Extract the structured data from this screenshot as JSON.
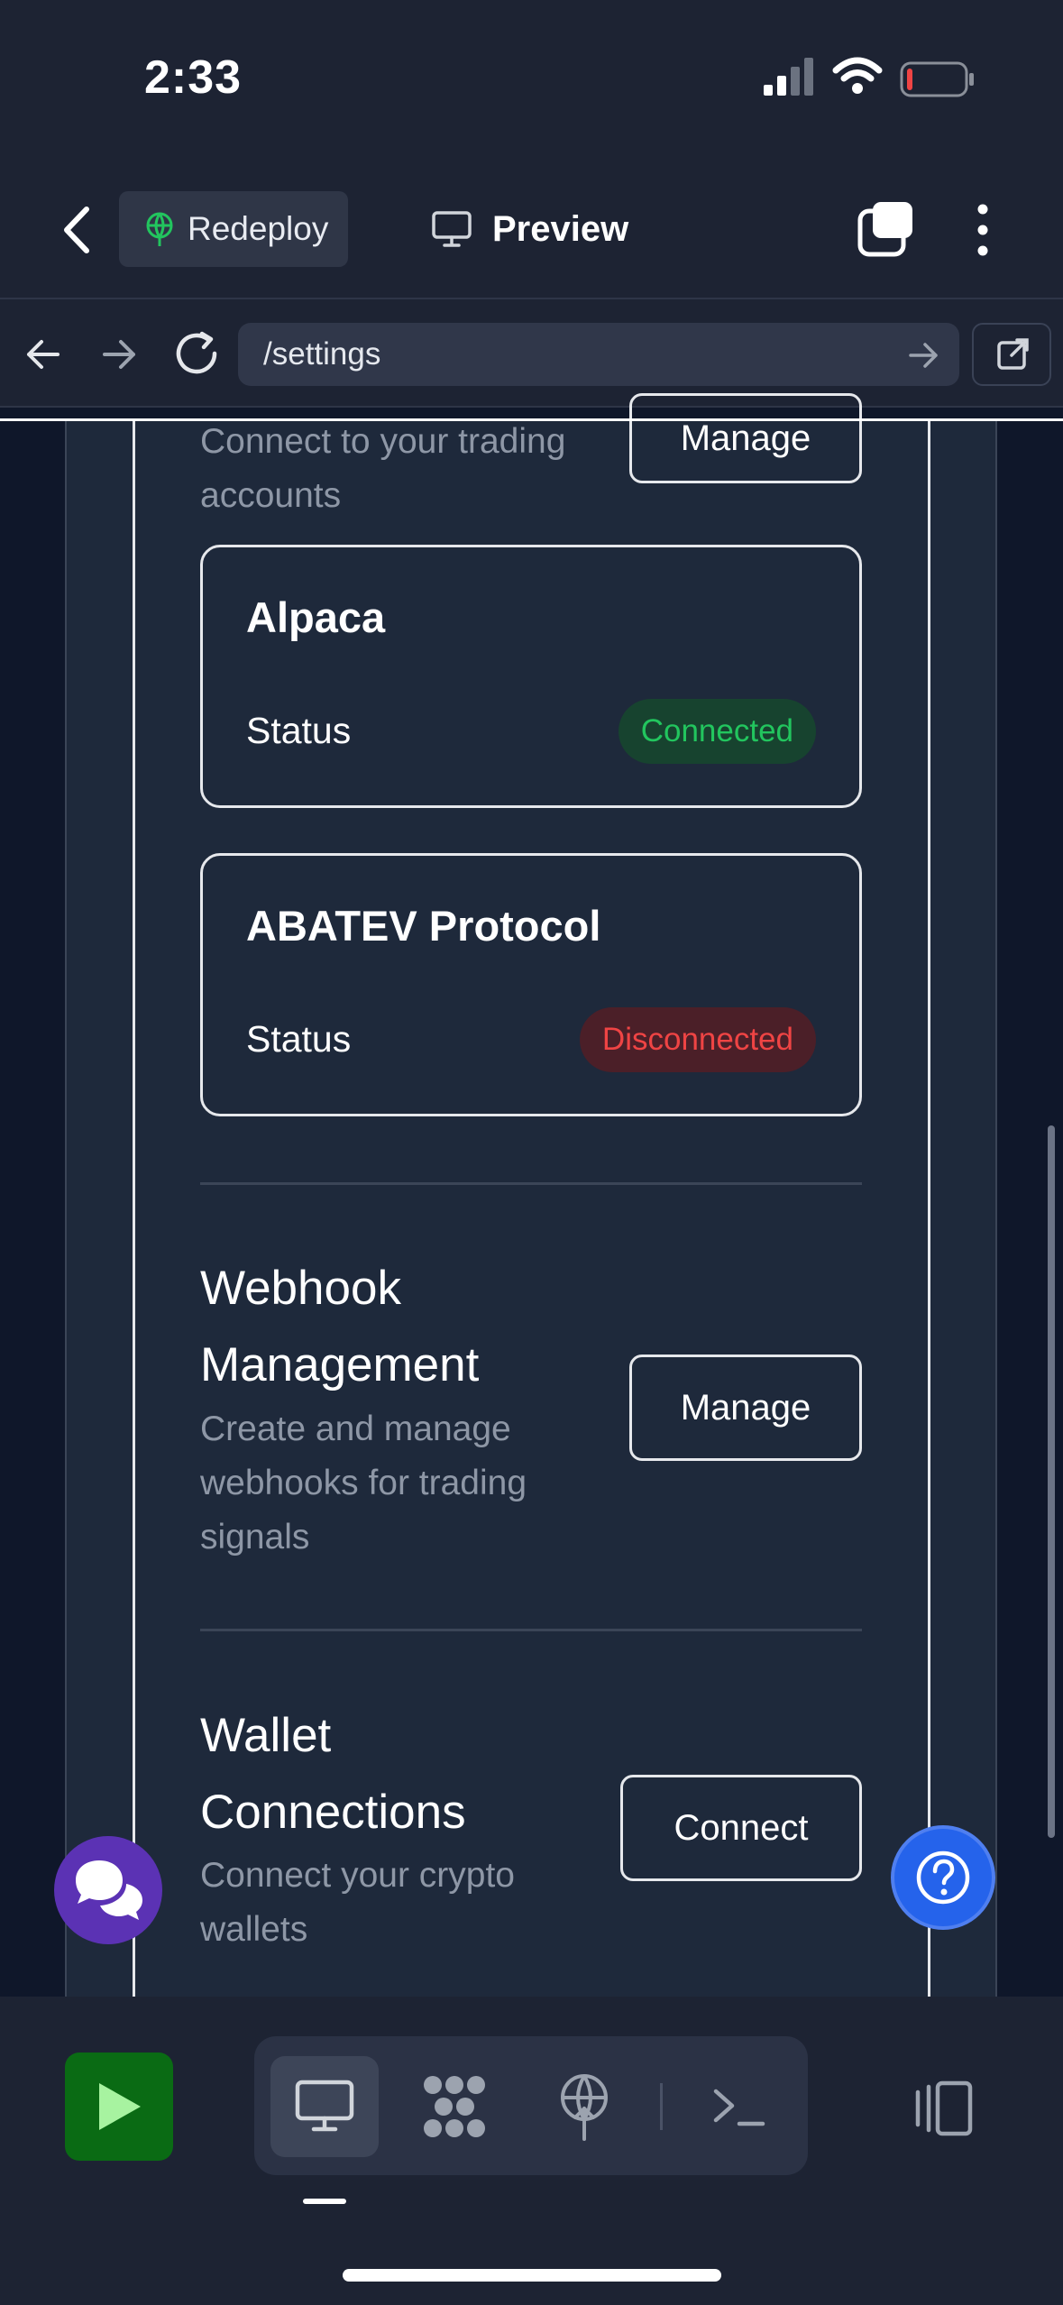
{
  "status_bar": {
    "time": "2:33"
  },
  "header": {
    "redeploy_label": "Redeploy",
    "preview_label": "Preview",
    "icons": [
      "back-icon",
      "redeploy-icon",
      "monitor-icon",
      "tabs-icon",
      "more-vertical-icon"
    ]
  },
  "browser": {
    "url": "/settings"
  },
  "trading": {
    "description": "Connect to your trading accounts",
    "manage_label": "Manage",
    "brokers": [
      {
        "name": "Alpaca",
        "status_label": "Status",
        "status": "Connected",
        "status_color": "#22c55e"
      },
      {
        "name": "ABATEV Protocol",
        "status_label": "Status",
        "status": "Disconnected",
        "status_color": "#ef4444"
      }
    ]
  },
  "webhook": {
    "title": "Webhook Management",
    "description": "Create and manage webhooks for trading signals",
    "button_label": "Manage"
  },
  "wallet": {
    "title": "Wallet Connections",
    "description": "Connect your crypto wallets",
    "button_label": "Connect"
  },
  "toolbar": {
    "icons": [
      "play-icon",
      "monitor-icon",
      "graph-icon",
      "deploy-icon",
      "terminal-icon",
      "panel-toggle-icon"
    ],
    "accent": "#0a6b14"
  },
  "floating": {
    "chat_color": "#5b32b4",
    "help_color": "#2563eb"
  }
}
